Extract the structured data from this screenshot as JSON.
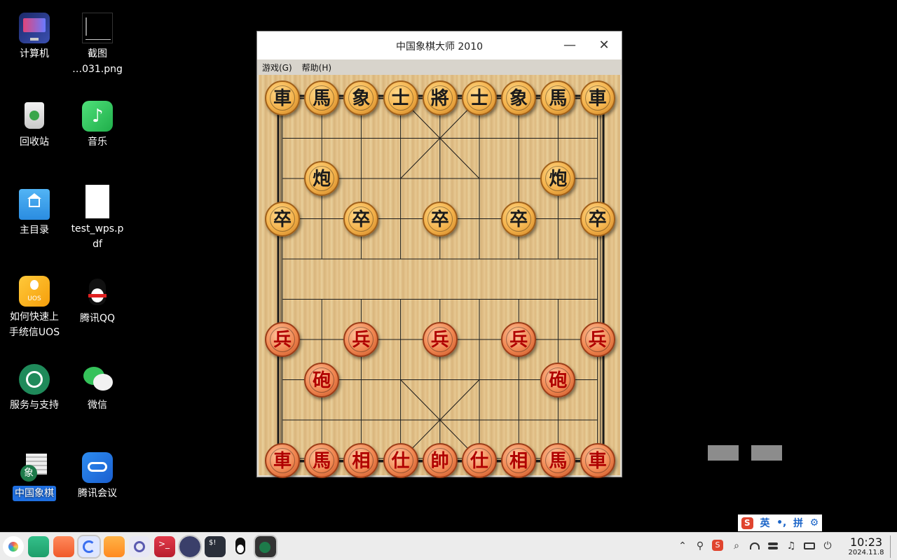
{
  "desktop": {
    "icons": [
      {
        "label": "计算机"
      },
      {
        "label": "截图\n…031.png"
      },
      {
        "label": "回收站"
      },
      {
        "label": "音乐"
      },
      {
        "label": "主目录"
      },
      {
        "label": "test_wps.p\ndf"
      },
      {
        "label": "如何快速上\n手统信UOS"
      },
      {
        "label": "腾讯QQ"
      },
      {
        "label": "服务与支持"
      },
      {
        "label": "微信"
      },
      {
        "label": "中国象棋"
      },
      {
        "label": "腾讯会议"
      }
    ],
    "selected_icon": "中国象棋"
  },
  "window": {
    "title": "中国象棋大师 2010",
    "minimize_glyph": "—",
    "close_glyph": "✕",
    "menu": [
      {
        "label": "游戏(G)"
      },
      {
        "label": "帮助(H)"
      }
    ]
  },
  "board": {
    "pieces": [
      {
        "side": "black",
        "char": "車",
        "file": 0,
        "rank": 0
      },
      {
        "side": "black",
        "char": "馬",
        "file": 1,
        "rank": 0
      },
      {
        "side": "black",
        "char": "象",
        "file": 2,
        "rank": 0
      },
      {
        "side": "black",
        "char": "士",
        "file": 3,
        "rank": 0
      },
      {
        "side": "black",
        "char": "將",
        "file": 4,
        "rank": 0
      },
      {
        "side": "black",
        "char": "士",
        "file": 5,
        "rank": 0
      },
      {
        "side": "black",
        "char": "象",
        "file": 6,
        "rank": 0
      },
      {
        "side": "black",
        "char": "馬",
        "file": 7,
        "rank": 0
      },
      {
        "side": "black",
        "char": "車",
        "file": 8,
        "rank": 0
      },
      {
        "side": "black",
        "char": "炮",
        "file": 1,
        "rank": 2
      },
      {
        "side": "black",
        "char": "炮",
        "file": 7,
        "rank": 2
      },
      {
        "side": "black",
        "char": "卒",
        "file": 0,
        "rank": 3
      },
      {
        "side": "black",
        "char": "卒",
        "file": 2,
        "rank": 3
      },
      {
        "side": "black",
        "char": "卒",
        "file": 4,
        "rank": 3
      },
      {
        "side": "black",
        "char": "卒",
        "file": 6,
        "rank": 3
      },
      {
        "side": "black",
        "char": "卒",
        "file": 8,
        "rank": 3
      },
      {
        "side": "red",
        "char": "兵",
        "file": 0,
        "rank": 6
      },
      {
        "side": "red",
        "char": "兵",
        "file": 2,
        "rank": 6
      },
      {
        "side": "red",
        "char": "兵",
        "file": 4,
        "rank": 6
      },
      {
        "side": "red",
        "char": "兵",
        "file": 6,
        "rank": 6
      },
      {
        "side": "red",
        "char": "兵",
        "file": 8,
        "rank": 6
      },
      {
        "side": "red",
        "char": "砲",
        "file": 1,
        "rank": 7
      },
      {
        "side": "red",
        "char": "砲",
        "file": 7,
        "rank": 7
      },
      {
        "side": "red",
        "char": "車",
        "file": 0,
        "rank": 9
      },
      {
        "side": "red",
        "char": "馬",
        "file": 1,
        "rank": 9
      },
      {
        "side": "red",
        "char": "相",
        "file": 2,
        "rank": 9
      },
      {
        "side": "red",
        "char": "仕",
        "file": 3,
        "rank": 9
      },
      {
        "side": "red",
        "char": "帥",
        "file": 4,
        "rank": 9
      },
      {
        "side": "red",
        "char": "仕",
        "file": 5,
        "rank": 9
      },
      {
        "side": "red",
        "char": "相",
        "file": 6,
        "rank": 9
      },
      {
        "side": "red",
        "char": "馬",
        "file": 7,
        "rank": 9
      },
      {
        "side": "red",
        "char": "車",
        "file": 8,
        "rank": 9
      }
    ]
  },
  "ime": {
    "logo": "S",
    "mode": "英",
    "punct": "•,",
    "pinyin": "拼",
    "settings_glyph": "⚙"
  },
  "taskbar": {
    "apps": [
      "launcher",
      "multitask-view",
      "app-store",
      "browser",
      "file-manager",
      "settings",
      "terminal",
      "system-monitor",
      "terminal-dark",
      "qq",
      "chinese-chess"
    ],
    "tray": [
      "chevron-up-icon",
      "usb-icon",
      "sogou-icon",
      "search-icon",
      "wifi-icon",
      "control-center-icon",
      "notification-icon",
      "battery-icon",
      "power-icon"
    ],
    "tray_glyphs": {
      "chevron": "⌃",
      "usb": "⚲",
      "search": "⌕",
      "notification": "♫",
      "power": "⏻"
    },
    "time": "10:23",
    "date": "2024.11.8"
  }
}
